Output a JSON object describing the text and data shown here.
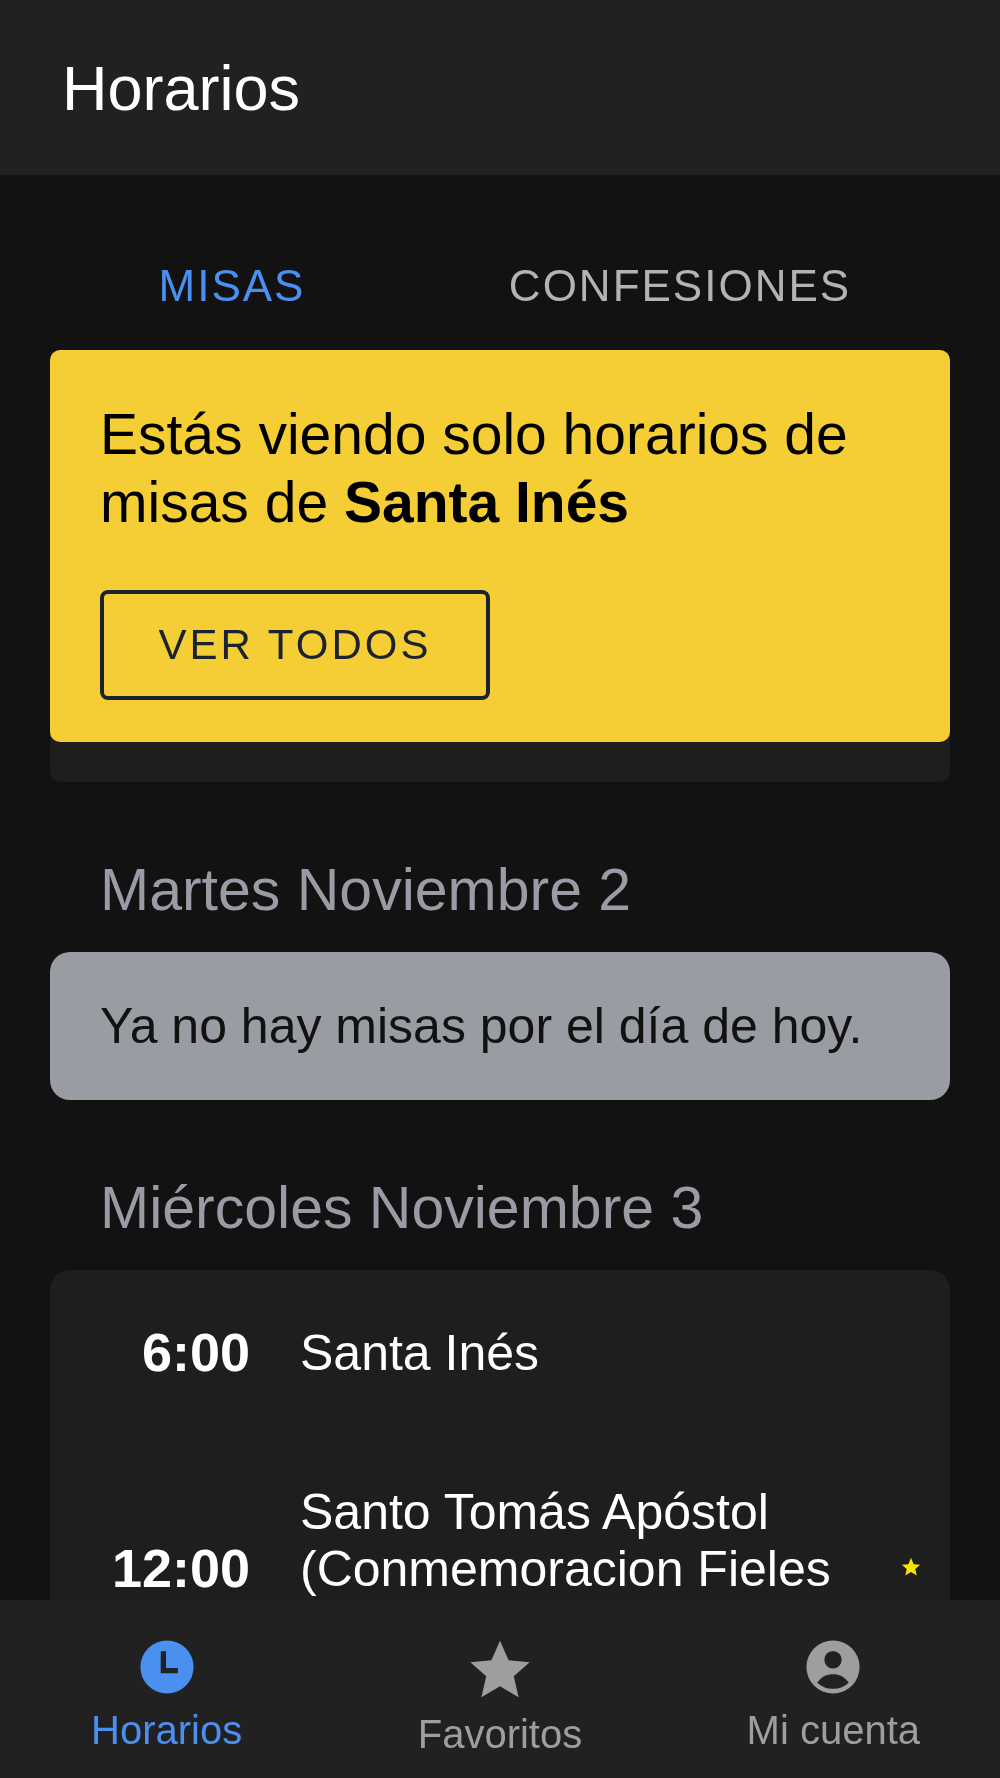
{
  "app_bar": {
    "title": "Horarios"
  },
  "tabs": [
    {
      "label": "MISAS",
      "selected": true
    },
    {
      "label": "CONFESIONES",
      "selected": false
    }
  ],
  "filter_banner": {
    "text": "Estás viendo solo horarios de misas de **Santa Inés**",
    "button": "VER TODOS"
  },
  "days": [
    {
      "heading": "Martes Noviembre 2",
      "empty_message": "Ya no hay misas por el día de hoy."
    },
    {
      "heading": "Miércoles Noviembre 3",
      "masses": [
        {
          "time": "6:00",
          "church": "Santa Inés",
          "favorite": false
        },
        {
          "time": "12:00",
          "church": "Santo Tomás Apóstol (Conmemoracion Fieles",
          "favorite": true
        }
      ]
    }
  ],
  "bottom_nav": [
    {
      "label": "Horarios",
      "selected": true
    },
    {
      "label": "Favoritos",
      "selected": false
    },
    {
      "label": "Mi cuenta",
      "selected": false
    }
  ]
}
